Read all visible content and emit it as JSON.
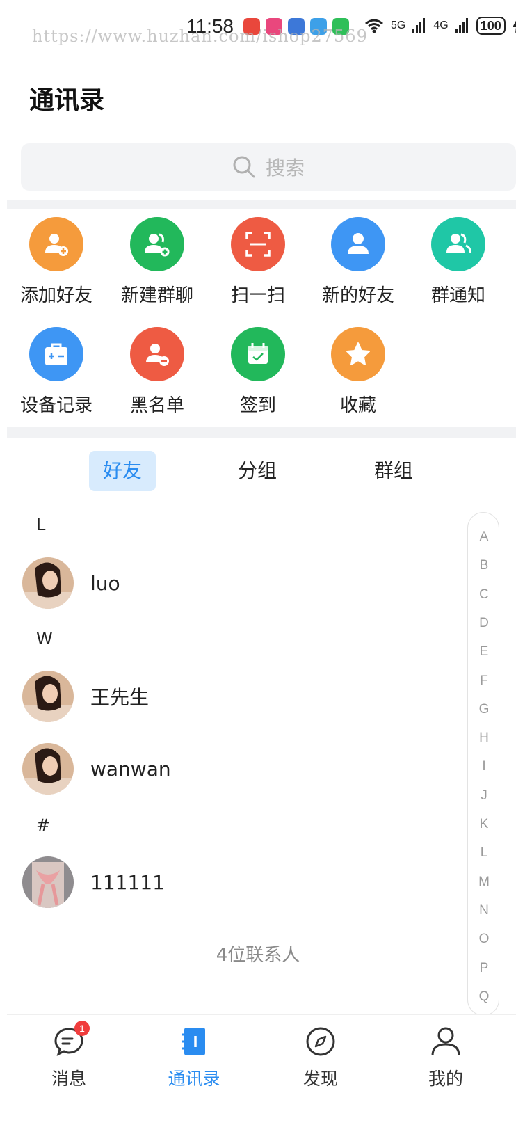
{
  "status_bar": {
    "time": "11:58",
    "watermark": "https://www.huzhan.com/ishop27569",
    "wifi_label": "⁶",
    "signal1": "5G",
    "signal2": "4G",
    "battery": "100"
  },
  "header": {
    "title": "通讯录"
  },
  "search": {
    "placeholder": "搜索"
  },
  "functions": [
    {
      "label": "添加好友",
      "icon": "add-friend-icon",
      "color": "#f59b3c"
    },
    {
      "label": "新建群聊",
      "icon": "new-group-icon",
      "color": "#22b85b"
    },
    {
      "label": "扫一扫",
      "icon": "scan-icon",
      "color": "#ee5b43"
    },
    {
      "label": "新的好友",
      "icon": "new-friend-icon",
      "color": "#3e96f4"
    },
    {
      "label": "群通知",
      "icon": "group-notice-icon",
      "color": "#1fc7a6"
    },
    {
      "label": "设备记录",
      "icon": "device-record-icon",
      "color": "#3e96f4"
    },
    {
      "label": "黑名单",
      "icon": "blacklist-icon",
      "color": "#ee5b43"
    },
    {
      "label": "签到",
      "icon": "checkin-icon",
      "color": "#22b85b"
    },
    {
      "label": "收藏",
      "icon": "favorite-icon",
      "color": "#f59b3c"
    }
  ],
  "tabs": [
    {
      "label": "好友",
      "active": true
    },
    {
      "label": "分组",
      "active": false
    },
    {
      "label": "群组",
      "active": false
    }
  ],
  "contacts": {
    "sections": [
      {
        "letter": "L",
        "items": [
          {
            "name": "luo"
          }
        ]
      },
      {
        "letter": "W",
        "items": [
          {
            "name": "王先生"
          },
          {
            "name": "wanwan"
          }
        ]
      },
      {
        "letter": "#",
        "items": [
          {
            "name": "111111"
          }
        ]
      }
    ],
    "count_text": "4位联系人"
  },
  "index_letters": [
    "A",
    "B",
    "C",
    "D",
    "E",
    "F",
    "G",
    "H",
    "I",
    "J",
    "K",
    "L",
    "M",
    "N",
    "O",
    "P",
    "Q"
  ],
  "tabbar": [
    {
      "label": "消息",
      "icon": "message-icon",
      "badge": "1",
      "active": false
    },
    {
      "label": "通讯录",
      "icon": "contacts-icon",
      "active": true
    },
    {
      "label": "发现",
      "icon": "compass-icon",
      "active": false
    },
    {
      "label": "我的",
      "icon": "profile-icon",
      "active": false
    }
  ],
  "colors": {
    "accent": "#2a8cf0",
    "badge": "#f03d3d"
  }
}
